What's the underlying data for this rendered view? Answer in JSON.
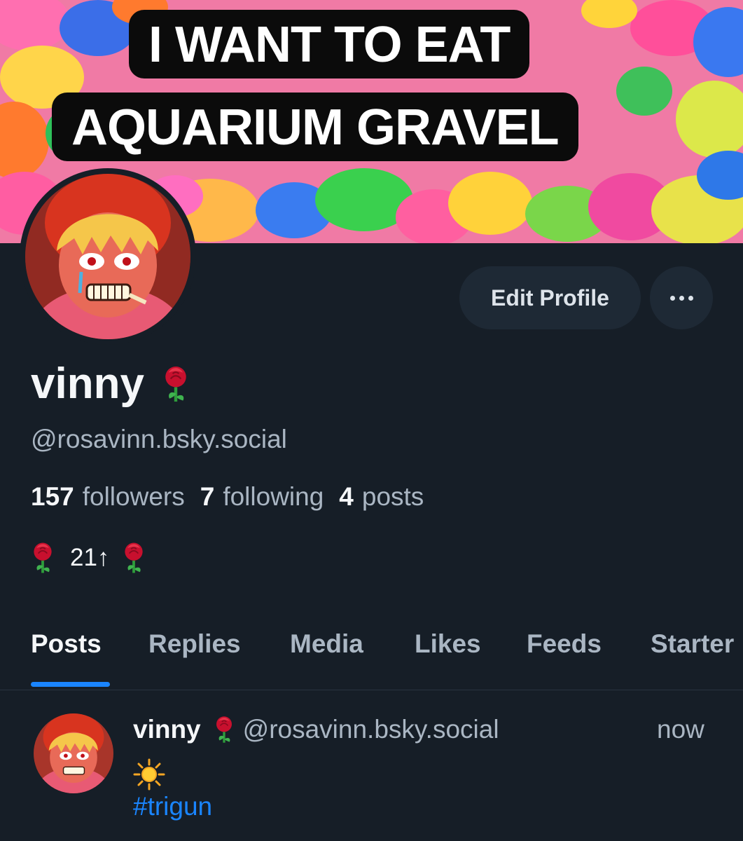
{
  "banner": {
    "caption_line1": "I WANT TO EAT",
    "caption_line2": "AQUARIUM GRAVEL"
  },
  "profile": {
    "display_name": "vinny",
    "name_emoji": "rose-icon",
    "handle": "@rosavinn.bsky.social",
    "edit_button_label": "Edit Profile",
    "more_icon": "ellipsis-icon"
  },
  "stats": {
    "followers_count": "157",
    "followers_label": "followers",
    "following_count": "7",
    "following_label": "following",
    "posts_count": "4",
    "posts_label": "posts"
  },
  "bio": {
    "text": "21↑"
  },
  "tabs": [
    {
      "label": "Posts",
      "active": true
    },
    {
      "label": "Replies",
      "active": false
    },
    {
      "label": "Media",
      "active": false
    },
    {
      "label": "Likes",
      "active": false
    },
    {
      "label": "Feeds",
      "active": false
    },
    {
      "label": "Starter",
      "active": false
    }
  ],
  "post": {
    "author_name": "vinny",
    "author_handle": "@rosavinn.bsky.social",
    "time": "now",
    "emoji": "sun-icon",
    "hashtag": "#trigun"
  },
  "colors": {
    "background": "#161e27",
    "button_bg": "#1e2935",
    "muted_text": "#aab6c3",
    "accent": "#1a85ff"
  }
}
